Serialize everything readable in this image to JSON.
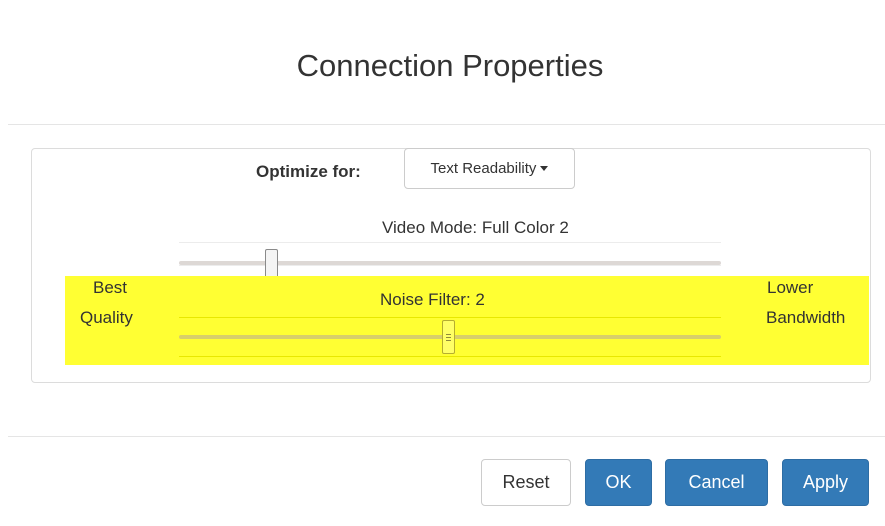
{
  "dialog": {
    "title": "Connection Properties"
  },
  "optimize": {
    "label": "Optimize for:",
    "selected": "Text Readability"
  },
  "video_mode": {
    "label": "Video Mode: Full Color 2",
    "level": 0.17
  },
  "noise_filter": {
    "label": "Noise Filter: 2",
    "level": 0.5,
    "left_label_line1": "Best",
    "left_label_line2": "Quality",
    "right_label_line1": "Lower",
    "right_label_line2": "Bandwidth"
  },
  "buttons": {
    "reset": "Reset",
    "ok": "OK",
    "cancel": "Cancel",
    "apply": "Apply"
  },
  "colors": {
    "highlight": "#ffff33",
    "primary": "#337ab7"
  },
  "icons": {
    "dropdown_caret": "caret-down-icon",
    "slider_grip": "grip-lines-icon"
  }
}
